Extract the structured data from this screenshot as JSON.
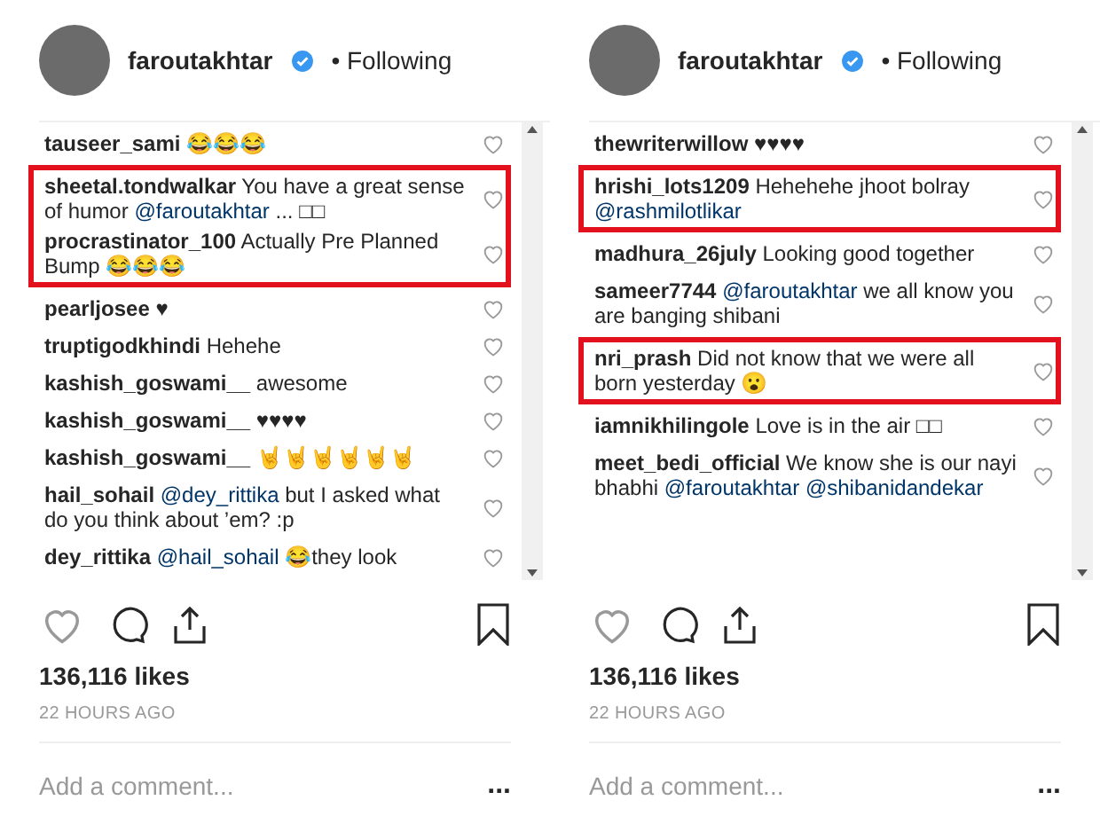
{
  "panels": [
    {
      "header": {
        "username": "faroutakhtar",
        "verified": true,
        "status": "• Following"
      },
      "comments": [
        {
          "user": "tauseer_sami",
          "parts": [
            {
              "text": "😂😂😂"
            }
          ],
          "highlighted": false
        },
        {
          "user": "sheetal.tondwalkar",
          "parts": [
            {
              "text": "You have a great sense of humor "
            },
            {
              "text": "@faroutakhtar",
              "mention": true
            },
            {
              "text": " ... □□"
            }
          ],
          "highlighted": true
        },
        {
          "user": "procrastinator_100",
          "parts": [
            {
              "text": "Actually Pre Planned Bump 😂😂😂"
            }
          ],
          "highlighted": true
        },
        {
          "user": "pearljosee",
          "parts": [
            {
              "text": "♥"
            }
          ],
          "highlighted": false
        },
        {
          "user": "truptigodkhindi",
          "parts": [
            {
              "text": "Hehehe"
            }
          ],
          "highlighted": false
        },
        {
          "user": "kashish_goswami__",
          "parts": [
            {
              "text": "awesome"
            }
          ],
          "highlighted": false
        },
        {
          "user": "kashish_goswami__",
          "parts": [
            {
              "text": "♥♥♥♥"
            }
          ],
          "highlighted": false
        },
        {
          "user": "kashish_goswami__",
          "parts": [
            {
              "text": "🤘🤘🤘🤘🤘🤘"
            }
          ],
          "highlighted": false
        },
        {
          "user": "hail_sohail",
          "parts": [
            {
              "text": "@dey_rittika",
              "mention": true
            },
            {
              "text": " but I asked what do you think about ’em? :p"
            }
          ],
          "highlighted": false
        },
        {
          "user": "dey_rittika",
          "parts": [
            {
              "text": "@hail_sohail",
              "mention": true
            },
            {
              "text": " 😂they look"
            }
          ],
          "highlighted": false
        }
      ],
      "likes": "136,116 likes",
      "time": "22 HOURS AGO",
      "comment_placeholder": "Add a comment...",
      "more": "..."
    },
    {
      "header": {
        "username": "faroutakhtar",
        "verified": true,
        "status": "• Following"
      },
      "comments": [
        {
          "user": "thewriterwillow",
          "parts": [
            {
              "text": "♥♥♥♥"
            }
          ],
          "highlighted": false
        },
        {
          "user": "hrishi_lots1209",
          "parts": [
            {
              "text": "Hehehehe jhoot bolray "
            },
            {
              "text": "@rashmilotlikar",
              "mention": true
            }
          ],
          "highlighted": true
        },
        {
          "user": "madhura_26july",
          "parts": [
            {
              "text": "Looking good together"
            }
          ],
          "highlighted": false
        },
        {
          "user": "sameer7744",
          "parts": [
            {
              "text": "@faroutakhtar",
              "mention": true
            },
            {
              "text": " we all know you are banging shibani"
            }
          ],
          "highlighted": false
        },
        {
          "user": "nri_prash",
          "parts": [
            {
              "text": "Did not know that we were all born yesterday 😮"
            }
          ],
          "highlighted": true
        },
        {
          "user": "iamnikhilingole",
          "parts": [
            {
              "text": "Love is in the air □□"
            }
          ],
          "highlighted": false
        },
        {
          "user": "meet_bedi_official",
          "parts": [
            {
              "text": "We know she is our nayi bhabhi "
            },
            {
              "text": "@faroutakhtar",
              "mention": true
            },
            {
              "text": "@shibanidandekar",
              "mention": true
            }
          ],
          "highlighted": false
        }
      ],
      "likes": "136,116 likes",
      "time": "22 HOURS AGO",
      "comment_placeholder": "Add a comment...",
      "more": "..."
    }
  ]
}
